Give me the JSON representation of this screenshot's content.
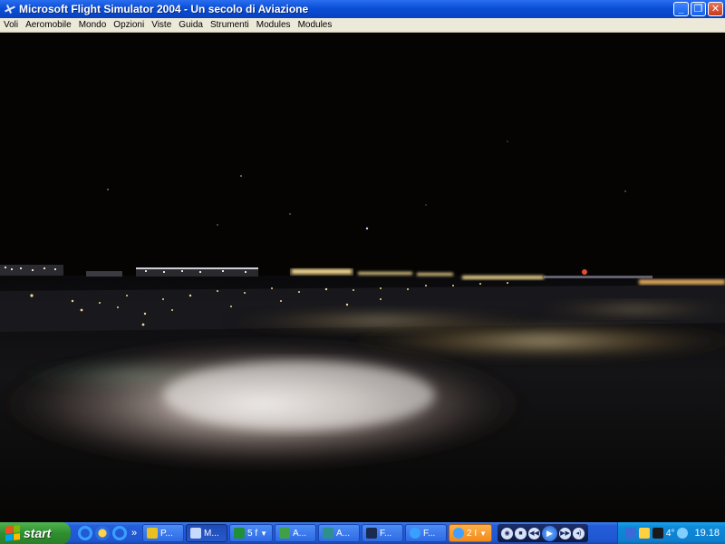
{
  "window": {
    "title": "Microsoft Flight Simulator 2004 - Un secolo di Aviazione",
    "controls": {
      "minimize": "_",
      "maximize": "❐",
      "close": "✕"
    }
  },
  "menu": {
    "items": [
      "Voli",
      "Aeromobile",
      "Mondo",
      "Opzioni",
      "Viste",
      "Guida",
      "Strumenti",
      "Modules",
      "Modules"
    ]
  },
  "taskbar": {
    "start_label": "start",
    "quicklaunch_more": "»",
    "tasks": [
      {
        "label": "P...",
        "icon": "picture-icon",
        "color": "#e8c020"
      },
      {
        "label": "M...",
        "icon": "airplane-icon",
        "color": "#c8d8ff",
        "active": true
      },
      {
        "label": "5 f",
        "icon": "excel-icon",
        "color": "#1f8f3a",
        "dropdown": true
      },
      {
        "label": "A...",
        "icon": "app-icon",
        "color": "#3fa048"
      },
      {
        "label": "A...",
        "icon": "app-icon",
        "color": "#2e8f8f"
      },
      {
        "label": "F...",
        "icon": "window-icon",
        "color": "#1a2a50"
      },
      {
        "label": "F...",
        "icon": "ie-icon",
        "color": "#3aa0ff"
      },
      {
        "label": "2 I",
        "icon": "messenger-icon",
        "color": "#40a0ff",
        "orange": true,
        "dropdown": true
      }
    ],
    "tray": {
      "language": "4°",
      "clock": "19.18"
    }
  }
}
